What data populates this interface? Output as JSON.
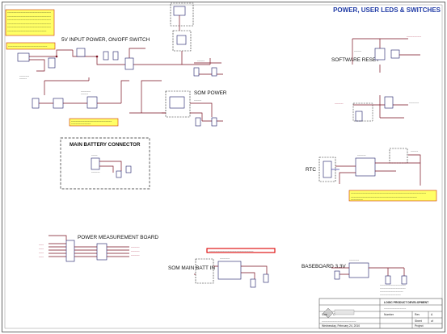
{
  "sheet": {
    "header_title": "POWER, USER LEDS & SWITCHES",
    "sections": {
      "input_power": "5V INPUT POWER, ON/OFF SWITCH",
      "software_reset": "SOFTWARE RESET",
      "som_power": "SOM POWER",
      "main_battery": "MAIN BATTERY CONNECTOR",
      "rtc": "RTC",
      "power_measurement": "POWER MEASUREMENT BOARD",
      "som_main_batt": "SOM MAIN BATT IN",
      "baseboard": "BASEBOARD 3.3V"
    },
    "title_block": {
      "company": "LOGIC PRODUCT DEVELOPMENT",
      "size_label": "Size",
      "size_value": "C",
      "number_label": "Number",
      "rev_label": "Rev",
      "rev_value": "A",
      "date_value": "Wednesday, February 24, 2010",
      "sheet_label": "Sheet",
      "of_label": "of",
      "project_label": "Project"
    }
  }
}
